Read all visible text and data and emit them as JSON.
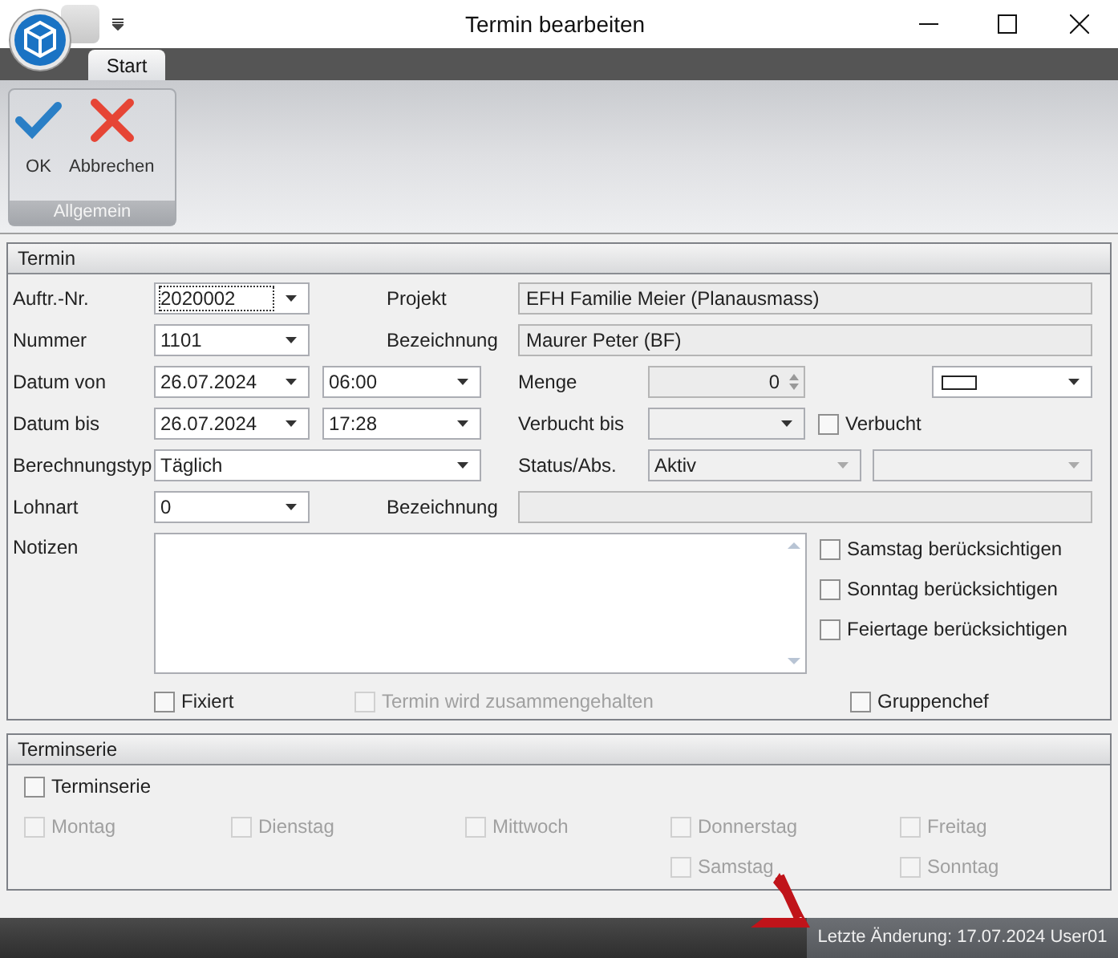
{
  "window": {
    "title": "Termin bearbeiten"
  },
  "ribbon": {
    "tabs": [
      {
        "label": "Start",
        "selected": true
      }
    ],
    "group": {
      "label": "Allgemein",
      "buttons": [
        {
          "kind": "ok",
          "label": "OK"
        },
        {
          "kind": "cancel",
          "label": "Abbrechen"
        }
      ]
    }
  },
  "termin": {
    "title": "Termin",
    "auftr_nr": {
      "label": "Auftr.-Nr.",
      "value": "2020002"
    },
    "projekt": {
      "label": "Projekt",
      "value": "EFH Familie Meier (Planausmass)"
    },
    "nummer": {
      "label": "Nummer",
      "value": "1101"
    },
    "bezeichnung_1": {
      "label": "Bezeichnung",
      "value": "Maurer Peter (BF)"
    },
    "datum_von": {
      "label": "Datum von",
      "date": "26.07.2024",
      "time": "06:00"
    },
    "menge": {
      "label": "Menge",
      "value": "0"
    },
    "datum_bis": {
      "label": "Datum bis",
      "date": "26.07.2024",
      "time": "17:28"
    },
    "verbucht_bis": {
      "label": "Verbucht bis"
    },
    "verbucht": {
      "label": "Verbucht",
      "checked": false,
      "disabled": false
    },
    "berechnungstyp": {
      "label": "Berechnungstyp",
      "value": "Täglich"
    },
    "status": {
      "label": "Status/Abs.",
      "value": "Aktiv"
    },
    "lohnart": {
      "label": "Lohnart",
      "value": "0"
    },
    "bezeichnung_2": {
      "label": "Bezeichnung"
    },
    "notizen": {
      "label": "Notizen"
    },
    "options": [
      {
        "label": "Samstag berücksichtigen",
        "checked": false,
        "disabled": false
      },
      {
        "label": "Sonntag berücksichtigen",
        "checked": false,
        "disabled": false
      },
      {
        "label": "Feiertage berücksichtigen",
        "checked": false,
        "disabled": false
      }
    ],
    "fixiert": {
      "label": "Fixiert",
      "checked": false,
      "disabled": false
    },
    "zusammen": {
      "label": "Termin wird zusammengehalten",
      "checked": false,
      "disabled": true
    },
    "gruppenchef": {
      "label": "Gruppenchef",
      "checked": false,
      "disabled": false
    }
  },
  "terminserie": {
    "title": "Terminserie",
    "series": {
      "label": "Terminserie",
      "checked": false,
      "disabled": false
    },
    "days": [
      {
        "label": "Montag",
        "checked": false,
        "disabled": true
      },
      {
        "label": "Dienstag",
        "checked": false,
        "disabled": true
      },
      {
        "label": "Mittwoch",
        "checked": false,
        "disabled": true
      },
      {
        "label": "Donnerstag",
        "checked": false,
        "disabled": true
      },
      {
        "label": "Freitag",
        "checked": false,
        "disabled": true
      },
      {
        "label": "Samstag",
        "checked": false,
        "disabled": true
      },
      {
        "label": "Sonntag",
        "checked": false,
        "disabled": true
      }
    ]
  },
  "status_bar": {
    "text": "Letzte Änderung: 17.07.2024 User01"
  }
}
